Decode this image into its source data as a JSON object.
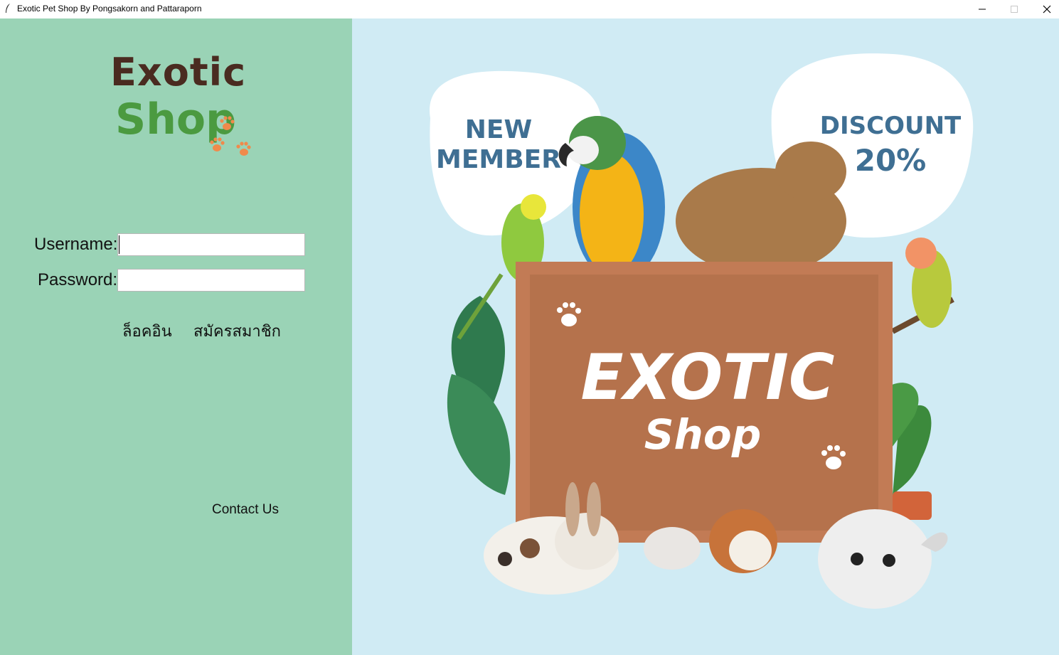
{
  "window": {
    "title": "Exotic Pet Shop By Pongsakorn and Pattaraporn"
  },
  "logo": {
    "line1": "Exotic",
    "line2": "Shop"
  },
  "form": {
    "username_label": "Username:",
    "password_label": "Password:",
    "username_value": "",
    "password_value": ""
  },
  "buttons": {
    "login": "ล็อคอิน",
    "register": "สมัครสมาชิก",
    "contact": "Contact Us"
  },
  "banner": {
    "bubble_left_line1": "NEW",
    "bubble_left_line2": "MEMBER",
    "bubble_right_line1": "DISCOUNT",
    "bubble_right_line2": "20%",
    "board_line1": "EXOTIC",
    "board_line2": "Shop"
  },
  "colors": {
    "left_panel": "#9ad3b6",
    "right_panel": "#d0ebf4",
    "logo_exotic": "#4a2b20",
    "logo_shop": "#4b9a40",
    "paw": "#f08a4b",
    "bubble_text": "#3f6f93",
    "cork_board": "#b5724c"
  }
}
